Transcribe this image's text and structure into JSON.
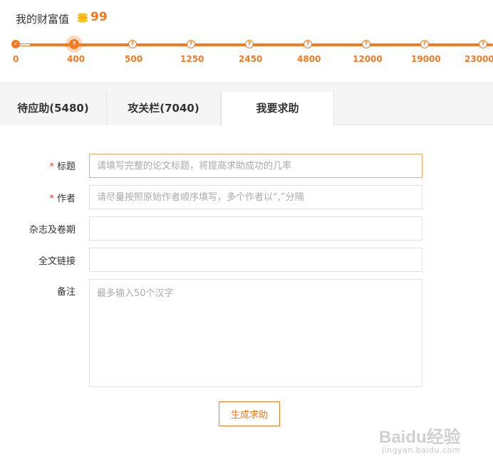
{
  "wealth": {
    "label": "我的财富值",
    "value": "99",
    "icon": "coin-stack-icon",
    "milestones": [
      "0",
      "400",
      "500",
      "1250",
      "2450",
      "4800",
      "12000",
      "19000",
      "23000"
    ],
    "node_glyphs": {
      "done": "✓",
      "locked": "?"
    },
    "accent_color": "#f47920"
  },
  "tabs": [
    {
      "label": "待应助(5480)"
    },
    {
      "label": "攻关栏(7040)"
    },
    {
      "label": "我要求助"
    }
  ],
  "form": {
    "required_mark": "*",
    "title": {
      "label": "标题",
      "placeholder": "请填写完整的论文标题，将提高求助成功的几率"
    },
    "author": {
      "label": "作者",
      "placeholder": "请尽量按照原始作者顺序填写，多个作者以“,”分隔"
    },
    "journal": {
      "label": "杂志及卷期",
      "placeholder": ""
    },
    "link": {
      "label": "全文链接",
      "placeholder": ""
    },
    "remark": {
      "label": "备注",
      "placeholder": "最多输入50个汉字"
    },
    "submit_label": "生成求助"
  },
  "watermark": {
    "logo": "Baidu经验",
    "url": "jingyan.baidu.com"
  }
}
